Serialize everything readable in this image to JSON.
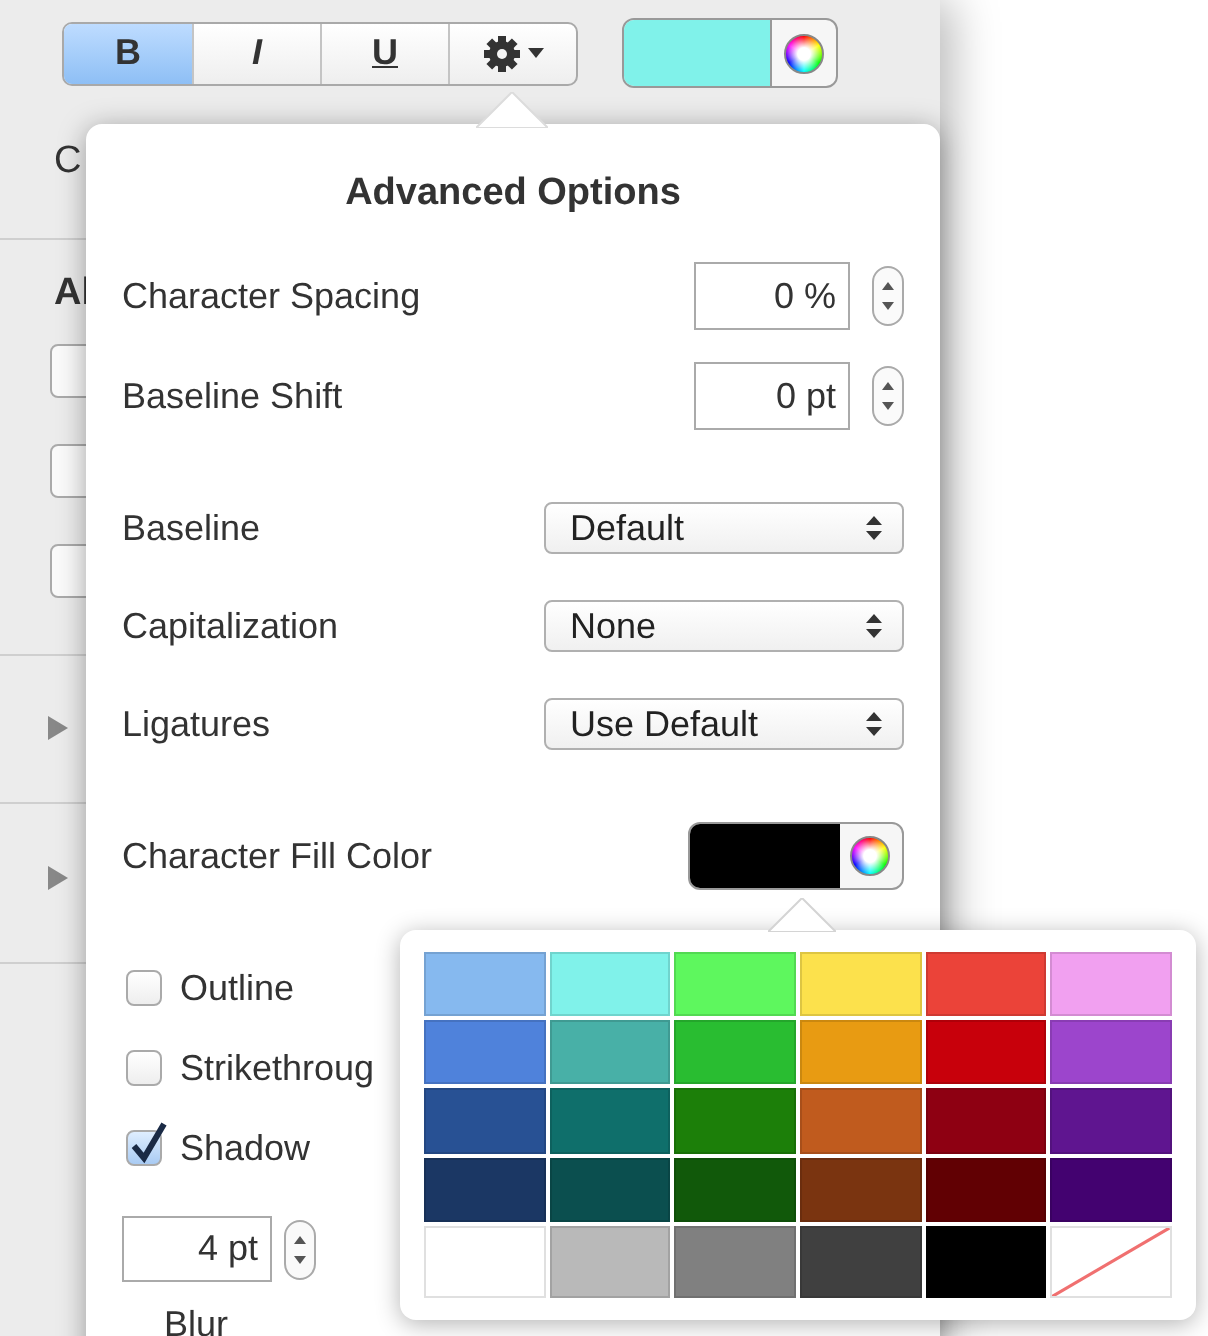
{
  "toolbar": {
    "style_buttons": [
      {
        "kind": "bold",
        "label": "B",
        "selected": true
      },
      {
        "kind": "italic",
        "label": "I",
        "selected": false
      },
      {
        "kind": "underline",
        "label": "U",
        "selected": false
      },
      {
        "kind": "gear",
        "selected": false
      }
    ],
    "color_well": {
      "color": "#80f2ea"
    }
  },
  "sidebar": {
    "section_1": "C",
    "section_2": "Al"
  },
  "advanced_options": {
    "title": "Advanced Options",
    "steppers": [
      {
        "label": "Character Spacing",
        "value": "0 %"
      },
      {
        "label": "Baseline Shift",
        "value": "0 pt"
      }
    ],
    "popups": [
      {
        "label": "Baseline",
        "value": "Default"
      },
      {
        "label": "Capitalization",
        "value": "None"
      },
      {
        "label": "Ligatures",
        "value": "Use Default"
      }
    ],
    "fill_color": {
      "label": "Character Fill Color",
      "color": "#000000"
    },
    "checkboxes": [
      {
        "label": "Outline",
        "checked": false
      },
      {
        "label": "Strikethroug",
        "checked": false
      },
      {
        "label": "Shadow",
        "checked": true
      }
    ],
    "shadow": {
      "blur": {
        "value": "4 pt",
        "label": "Blur"
      }
    }
  },
  "color_palette": {
    "swatches": [
      {
        "kind": "solid",
        "color": "#86b9ef"
      },
      {
        "kind": "solid",
        "color": "#80f2ea"
      },
      {
        "kind": "solid",
        "color": "#5ef75e"
      },
      {
        "kind": "solid",
        "color": "#fce14c"
      },
      {
        "kind": "solid",
        "color": "#eb4339"
      },
      {
        "kind": "solid",
        "color": "#f1a0f0"
      },
      {
        "kind": "solid",
        "color": "#4f82db"
      },
      {
        "kind": "solid",
        "color": "#48b0a7"
      },
      {
        "kind": "solid",
        "color": "#29bd31"
      },
      {
        "kind": "solid",
        "color": "#e89b12"
      },
      {
        "kind": "solid",
        "color": "#c8000b"
      },
      {
        "kind": "solid",
        "color": "#9c45cc"
      },
      {
        "kind": "solid",
        "color": "#285194"
      },
      {
        "kind": "solid",
        "color": "#0f6f6b"
      },
      {
        "kind": "solid",
        "color": "#1c7f09"
      },
      {
        "kind": "solid",
        "color": "#c05b1e"
      },
      {
        "kind": "solid",
        "color": "#8e0012"
      },
      {
        "kind": "solid",
        "color": "#5f1590"
      },
      {
        "kind": "solid",
        "color": "#1b3764"
      },
      {
        "kind": "solid",
        "color": "#0b4f4f"
      },
      {
        "kind": "solid",
        "color": "#11590a"
      },
      {
        "kind": "solid",
        "color": "#7a3410"
      },
      {
        "kind": "solid",
        "color": "#610003"
      },
      {
        "kind": "solid",
        "color": "#430270"
      },
      {
        "kind": "solid",
        "color": "#ffffff"
      },
      {
        "kind": "solid",
        "color": "#b9b9b9"
      },
      {
        "kind": "solid",
        "color": "#808080"
      },
      {
        "kind": "solid",
        "color": "#404040"
      },
      {
        "kind": "solid",
        "color": "#000000"
      },
      {
        "kind": "none"
      }
    ]
  }
}
